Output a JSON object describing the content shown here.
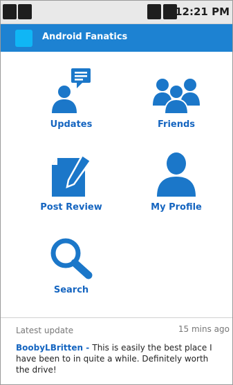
{
  "status_bar": {
    "time": "12:21 PM"
  },
  "action_bar": {
    "title": "Android Fanatics"
  },
  "dashboard": {
    "updates_label": "Updates",
    "friends_label": "Friends",
    "post_review_label": "Post Review",
    "my_profile_label": "My Profile",
    "search_label": "Search"
  },
  "latest_update": {
    "header": "Latest update",
    "time_ago": "15 mins ago",
    "author": "BoobyLBritten",
    "separator": " - ",
    "message": "This is easily the best place I have been to in quite a while. Definitely worth the drive!"
  },
  "colors": {
    "action_bar": "#1d82d2",
    "app_icon": "#10b6f5",
    "accent_text": "#1565c0",
    "icon_blue": "#1b77c9"
  }
}
